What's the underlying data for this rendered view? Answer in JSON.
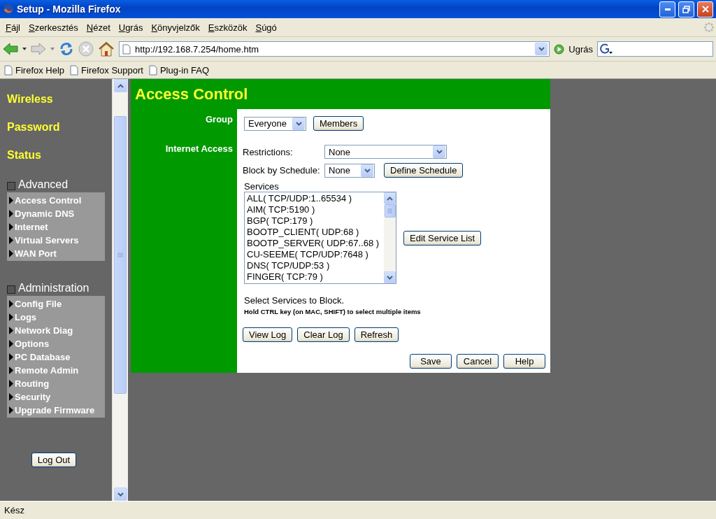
{
  "window": {
    "title": "Setup - Mozilla Firefox"
  },
  "menu": [
    "Fájl",
    "Szerkesztés",
    "Nézet",
    "Ugrás",
    "Könyvjelzők",
    "Eszközök",
    "Súgó"
  ],
  "toolbar": {
    "url": "http://192.168.7.254/home.htm",
    "go_label": "Ugrás"
  },
  "bookmarks": [
    "Firefox Help",
    "Firefox Support",
    "Plug-in FAQ"
  ],
  "sidebar": {
    "links": [
      "Wireless",
      "Password",
      "Status"
    ],
    "sections": [
      {
        "title": "Advanced",
        "checked": false,
        "items": [
          "Access Control",
          "Dynamic DNS",
          "Internet",
          "Virtual Servers",
          "WAN Port"
        ]
      },
      {
        "title": "Administration",
        "checked": false,
        "items": [
          "Config File",
          "Logs",
          "Network Diag",
          "Options",
          "PC Database",
          "Remote Admin",
          "Routing",
          "Security",
          "Upgrade Firmware"
        ]
      }
    ],
    "logout": "Log Out"
  },
  "page": {
    "title": "Access Control",
    "group": {
      "label": "Group",
      "value": "Everyone",
      "button": "Members"
    },
    "internet_access": {
      "label": "Internet Access",
      "restrictions": {
        "label": "Restrictions:",
        "value": "None"
      },
      "schedule": {
        "label": "Block by Schedule:",
        "value": "None",
        "button": "Define Schedule"
      },
      "services": {
        "label": "Services",
        "items": [
          "ALL( TCP/UDP:1..65534 )",
          "AIM( TCP:5190 )",
          "BGP( TCP:179 )",
          "BOOTP_CLIENT( UDP:68 )",
          "BOOTP_SERVER( UDP:67..68 )",
          "CU-SEEME( TCP/UDP:7648 )",
          "DNS( TCP/UDP:53 )",
          "FINGER( TCP:79 )"
        ],
        "button": "Edit Service List"
      },
      "hint": "Select Services to Block.",
      "note": "Hold CTRL key (on MAC, SHIFT) to select multiple items",
      "log_buttons": [
        "View Log",
        "Clear Log",
        "Refresh"
      ]
    },
    "actions": [
      "Save",
      "Cancel",
      "Help"
    ]
  },
  "status_bar": "Kész"
}
